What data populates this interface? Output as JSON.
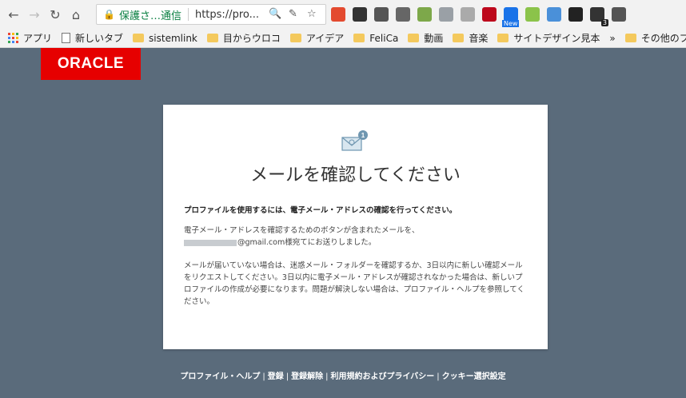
{
  "browser": {
    "secure_label": "保護さ…通信",
    "url": "https://pro...",
    "extensions": [
      {
        "name": "eyedropper",
        "color": "#e34a2f"
      },
      {
        "name": "settings",
        "color": "#333333"
      },
      {
        "name": "evernote",
        "color": "#555555"
      },
      {
        "name": "circle-ext",
        "color": "#666666"
      },
      {
        "name": "sheet",
        "color": "#7da84a"
      },
      {
        "name": "flash",
        "color": "#9aa0a6"
      },
      {
        "name": "rss",
        "color": "#aaaaaa"
      },
      {
        "name": "pinterest",
        "color": "#bd081c"
      },
      {
        "name": "new-ext",
        "color": "#1a73e8",
        "badge": "New"
      },
      {
        "name": "android",
        "color": "#8bc34a"
      },
      {
        "name": "tab-ext",
        "color": "#4a90d9"
      },
      {
        "name": "terminal",
        "color": "#222222"
      },
      {
        "name": "eye",
        "color": "#333333",
        "badge": "3"
      },
      {
        "name": "ext-last",
        "color": "#555555"
      }
    ]
  },
  "bookmarks": {
    "apps_label": "アプリ",
    "new_tab": "新しいタブ",
    "items": [
      "sistemlink",
      "目からウロコ",
      "アイデア",
      "FeliCa",
      "動画",
      "音楽",
      "サイトデザイン見本"
    ],
    "more": "»",
    "other": "その他のブックマ"
  },
  "logo": "ORACLE",
  "card": {
    "heading": "メールを確認してください",
    "lead": "プロファイルを使用するには、電子メール・アドレスの確認を行ってください。",
    "para1_line1": "電子メール・アドレスを確認するためのボタンが含まれたメールを、",
    "para1_email_domain": "@gmail.com",
    "para1_line2_rest": "様宛てにお送りしました。",
    "para2": "メールが届いていない場合は、迷惑メール・フォルダーを確認するか、3日以内に新しい確認メールをリクエストしてください。3日以内に電子メール・アドレスが確認されなかった場合は、新しいプロファイルの作成が必要になります。問題が解決しない場合は、プロファイル・ヘルプを参照してください。"
  },
  "footer": {
    "links": [
      "プロファイル・ヘルプ",
      "登録",
      "登録解除",
      "利用規約およびプライバシー",
      "クッキー選択設定"
    ],
    "separator": "|"
  },
  "colors": {
    "page_bg": "#5a6b7b",
    "oracle_red": "#e60000",
    "secure_green": "#0b8043"
  }
}
